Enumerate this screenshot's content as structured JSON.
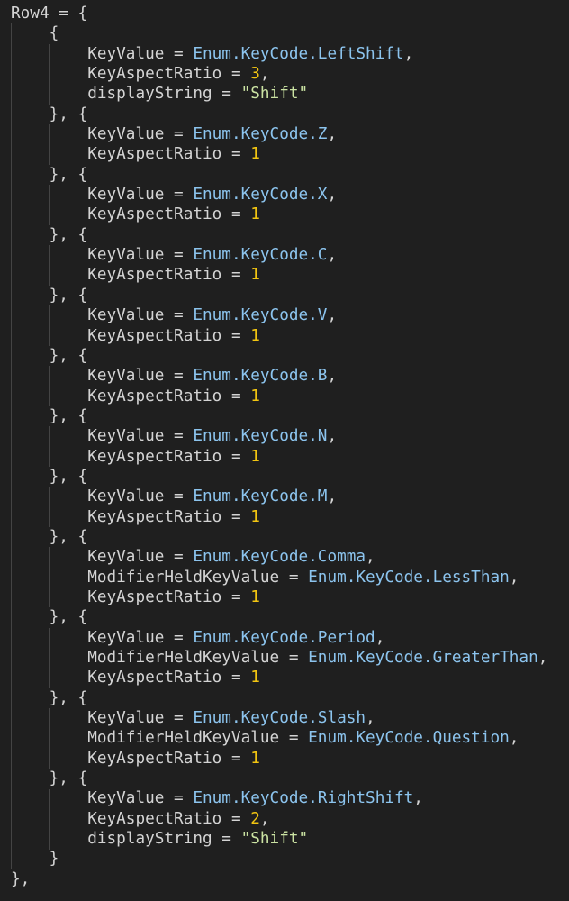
{
  "editor": {
    "variable": "Row4",
    "enum_prefix": "Enum.KeyCode.",
    "fields": {
      "key": "KeyValue",
      "modifier": "ModifierHeldKeyValue",
      "ratio": "KeyAspectRatio",
      "display": "displayString"
    },
    "entries": [
      {
        "key": "LeftShift",
        "ratio": "3",
        "display": "\"Shift\""
      },
      {
        "key": "Z",
        "ratio": "1"
      },
      {
        "key": "X",
        "ratio": "1"
      },
      {
        "key": "C",
        "ratio": "1"
      },
      {
        "key": "V",
        "ratio": "1"
      },
      {
        "key": "B",
        "ratio": "1"
      },
      {
        "key": "N",
        "ratio": "1"
      },
      {
        "key": "M",
        "ratio": "1"
      },
      {
        "key": "Comma",
        "modifier": "LessThan",
        "ratio": "1"
      },
      {
        "key": "Period",
        "modifier": "GreaterThan",
        "ratio": "1"
      },
      {
        "key": "Slash",
        "modifier": "Question",
        "ratio": "1"
      },
      {
        "key": "RightShift",
        "ratio": "2",
        "display": "\"Shift\""
      }
    ],
    "colors": {
      "background": "#1f1f1f",
      "text": "#d4d4d4",
      "enum": "#8cc4ee",
      "number": "#f2c511",
      "string": "#cbe3a3"
    }
  }
}
